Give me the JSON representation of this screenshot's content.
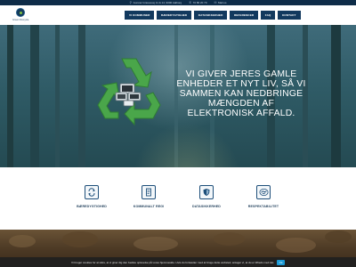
{
  "topbar": {
    "address": "Gunnar Gravesvej 11 & 14, 9000 Aalborg",
    "phone": "70 80 20 70",
    "email_label": "Mail os",
    "icons": [
      "map-pin-icon",
      "phone-icon",
      "mail-icon"
    ]
  },
  "brand": {
    "logo_text": "Green Recycle"
  },
  "nav": {
    "items": [
      "VI KOMMUNER",
      "BÆREDYGTIGHED",
      "DATASIKKERHED",
      "REFERENCER",
      "FAQ",
      "KONTAKT"
    ]
  },
  "hero": {
    "headline": "VI GIVER JERES GAMLE ENHEDER ET NYT LIV, SÅ VI SAMMEN KAN NEDBRINGE MÆNGDEN AF ELEKTRONISK AFFALD."
  },
  "features": [
    {
      "label": "BÆREDYGTIGHED",
      "icon": "recycle-icon"
    },
    {
      "label": "KOMMUNALT REGI",
      "icon": "document-icon"
    },
    {
      "label": "DATASIKKERHED",
      "icon": "shield-icon"
    },
    {
      "label": "RESPEKTABILITET",
      "icon": "handshake-icon"
    }
  ],
  "cookie": {
    "text": "Vi bruger cookies for at sikre, at vi giver dig den bedste oplevelse på vores hjemmeside. Hvis du fortsætter med at bruge dette websted, antager vi, at du er tilfreds med det.",
    "button_label": "Ok"
  },
  "colors": {
    "topbar": "#0e2c48",
    "nav_bg": "#12395e",
    "accent_green": "#4aa64a",
    "cookie_button": "#1b9ad6"
  }
}
